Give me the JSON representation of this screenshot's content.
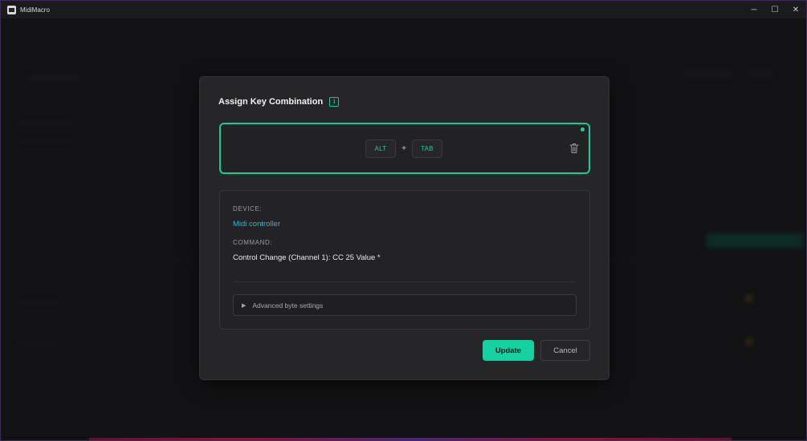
{
  "window": {
    "title": "MidiMacro",
    "controls": [
      "─",
      "☐",
      "✕"
    ]
  },
  "dialog": {
    "title": "Assign Key Combination",
    "info_icon": "i",
    "keys": [
      "ALT",
      "TAB"
    ],
    "separator": "+",
    "device_label": "DEVICE:",
    "device_value": "Midi controller",
    "command_label": "COMMAND:",
    "command_value": "Control Change (Channel 1): CC 25 Value *",
    "advanced_label": "Advanced byte settings",
    "update_label": "Update",
    "cancel_label": "Cancel"
  },
  "icons": {
    "app": "app-icon",
    "info": "info-icon",
    "delete": "trash-icon",
    "expand": "triangle-right-icon",
    "status": "status-dot"
  },
  "colors": {
    "accent": "#17d0a0",
    "link": "#2bb8e0",
    "dialog_bg": "#262628",
    "window_bg": "#161618"
  }
}
